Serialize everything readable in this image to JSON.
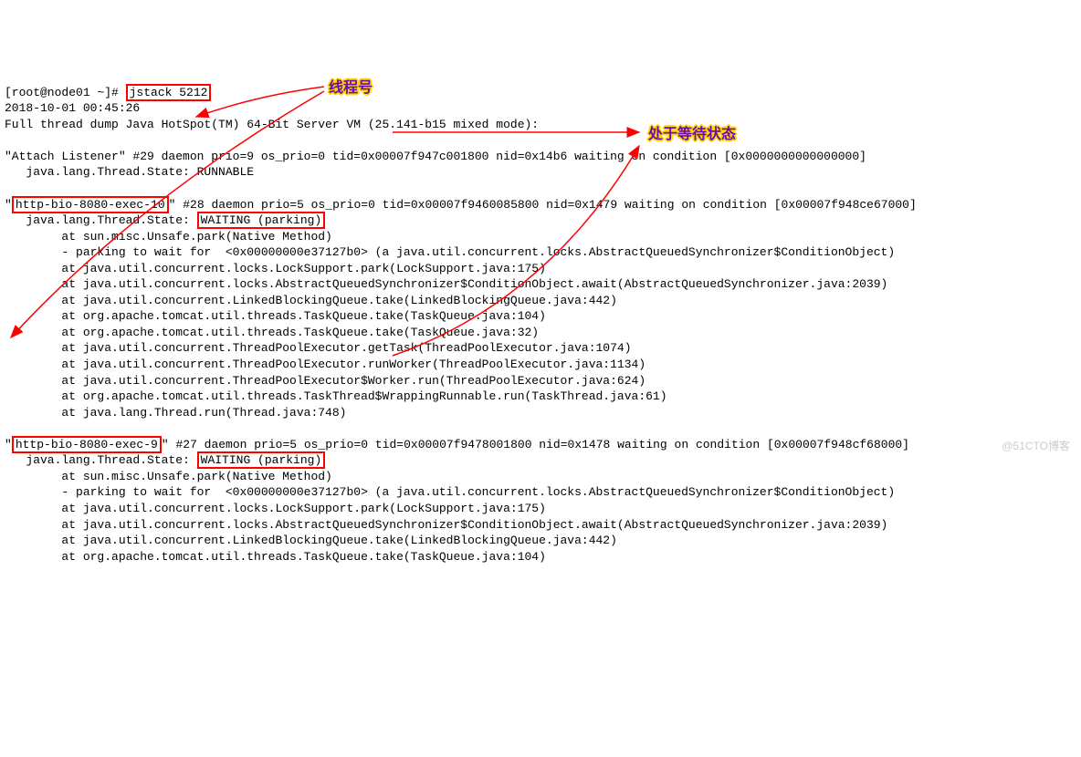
{
  "prompt": "[root@node01 ~]# ",
  "command": "jstack 5212",
  "timestamp": "2018-10-01 00:45:26",
  "header_line": "Full thread dump Java HotSpot(TM) 64-Bit Server VM (25.141-b15 mixed mode):",
  "blank": "",
  "thread1": {
    "header": "\"Attach Listener\" #29 daemon prio=9 os_prio=0 tid=0x00007f947c001800 nid=0x14b6 waiting on condition [0x0000000000000000]",
    "state_line": "   java.lang.Thread.State: RUNNABLE"
  },
  "thread2": {
    "pre": "\"",
    "name_box": "http-bio-8080-exec-10",
    "rest": "\" #28 daemon prio=5 os_prio=0 tid=0x00007f9460085800 nid=0x1479 waiting on condition [0x00007f948ce67000]",
    "state_pre": "   java.lang.Thread.State: ",
    "state_box": "WAITING (parking)",
    "stack": [
      "        at sun.misc.Unsafe.park(Native Method)",
      "        - parking to wait for  <0x00000000e37127b0> (a java.util.concurrent.locks.AbstractQueuedSynchronizer$ConditionObject)",
      "        at java.util.concurrent.locks.LockSupport.park(LockSupport.java:175)",
      "        at java.util.concurrent.locks.AbstractQueuedSynchronizer$ConditionObject.await(AbstractQueuedSynchronizer.java:2039)",
      "        at java.util.concurrent.LinkedBlockingQueue.take(LinkedBlockingQueue.java:442)",
      "        at org.apache.tomcat.util.threads.TaskQueue.take(TaskQueue.java:104)",
      "        at org.apache.tomcat.util.threads.TaskQueue.take(TaskQueue.java:32)",
      "        at java.util.concurrent.ThreadPoolExecutor.getTask(ThreadPoolExecutor.java:1074)",
      "        at java.util.concurrent.ThreadPoolExecutor.runWorker(ThreadPoolExecutor.java:1134)",
      "        at java.util.concurrent.ThreadPoolExecutor$Worker.run(ThreadPoolExecutor.java:624)",
      "        at org.apache.tomcat.util.threads.TaskThread$WrappingRunnable.run(TaskThread.java:61)",
      "        at java.lang.Thread.run(Thread.java:748)"
    ]
  },
  "thread3": {
    "pre": "\"",
    "name_box": "http-bio-8080-exec-9",
    "rest": "\" #27 daemon prio=5 os_prio=0 tid=0x00007f9478001800 nid=0x1478 waiting on condition [0x00007f948cf68000]",
    "state_pre": "   java.lang.Thread.State: ",
    "state_box": "WAITING (parking)",
    "stack": [
      "        at sun.misc.Unsafe.park(Native Method)",
      "        - parking to wait for  <0x00000000e37127b0> (a java.util.concurrent.locks.AbstractQueuedSynchronizer$ConditionObject)",
      "        at java.util.concurrent.locks.LockSupport.park(LockSupport.java:175)",
      "        at java.util.concurrent.locks.AbstractQueuedSynchronizer$ConditionObject.await(AbstractQueuedSynchronizer.java:2039)",
      "        at java.util.concurrent.LinkedBlockingQueue.take(LinkedBlockingQueue.java:442)",
      "        at org.apache.tomcat.util.threads.TaskQueue.take(TaskQueue.java:104)"
    ]
  },
  "annotations": {
    "thread_number": "线程号",
    "waiting_state": "处于等待状态"
  },
  "watermark": "@51CTO博客"
}
